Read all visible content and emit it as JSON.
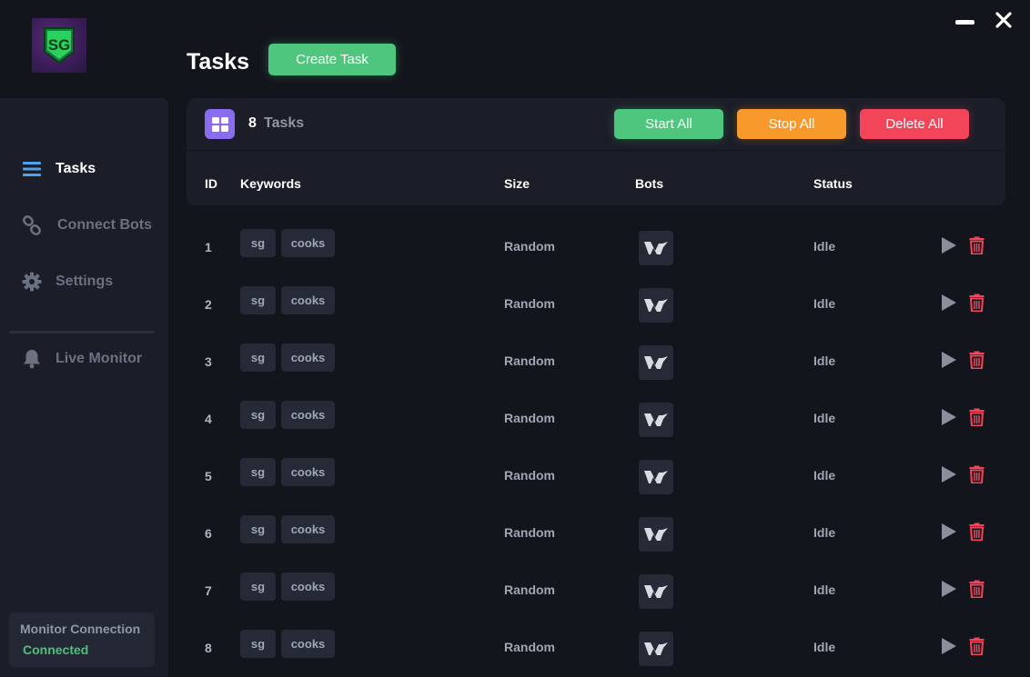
{
  "app": {
    "logo_text": "SG",
    "window": {
      "minimize_icon": "minimize-icon",
      "close_icon": "close-icon"
    }
  },
  "sidebar": {
    "items": [
      {
        "label": "Tasks",
        "icon": "list-icon",
        "active": true
      },
      {
        "label": "Connect Bots",
        "icon": "link-icon",
        "active": false
      },
      {
        "label": "Settings",
        "icon": "gear-icon",
        "active": false
      },
      {
        "label": "Live Monitor",
        "icon": "bell-icon",
        "active": false
      }
    ],
    "monitor": {
      "title": "Monitor Connection",
      "status": "Connected"
    }
  },
  "header": {
    "title": "Tasks",
    "create_label": "Create Task"
  },
  "panel": {
    "count": "8",
    "count_label": "Tasks",
    "start_all_label": "Start All",
    "stop_all_label": "Stop All",
    "delete_all_label": "Delete All",
    "columns": [
      "ID",
      "Keywords",
      "Size",
      "Bots",
      "Status"
    ]
  },
  "tasks": [
    {
      "id": "1",
      "keywords": [
        "sg",
        "cooks"
      ],
      "size": "Random",
      "bot_icon": "bot-logo-icon",
      "status": "Idle"
    },
    {
      "id": "2",
      "keywords": [
        "sg",
        "cooks"
      ],
      "size": "Random",
      "bot_icon": "bot-logo-icon",
      "status": "Idle"
    },
    {
      "id": "3",
      "keywords": [
        "sg",
        "cooks"
      ],
      "size": "Random",
      "bot_icon": "bot-logo-icon",
      "status": "Idle"
    },
    {
      "id": "4",
      "keywords": [
        "sg",
        "cooks"
      ],
      "size": "Random",
      "bot_icon": "bot-logo-icon",
      "status": "Idle"
    },
    {
      "id": "5",
      "keywords": [
        "sg",
        "cooks"
      ],
      "size": "Random",
      "bot_icon": "bot-logo-icon",
      "status": "Idle"
    },
    {
      "id": "6",
      "keywords": [
        "sg",
        "cooks"
      ],
      "size": "Random",
      "bot_icon": "bot-logo-icon",
      "status": "Idle"
    },
    {
      "id": "7",
      "keywords": [
        "sg",
        "cooks"
      ],
      "size": "Random",
      "bot_icon": "bot-logo-icon",
      "status": "Idle"
    },
    {
      "id": "8",
      "keywords": [
        "sg",
        "cooks"
      ],
      "size": "Random",
      "bot_icon": "bot-logo-icon",
      "status": "Idle"
    }
  ],
  "colors": {
    "background": "#13151d",
    "panel": "#1b1e28",
    "green": "#4fc67d",
    "orange": "#f79a2b",
    "red": "#f2455a",
    "purple": "#8a6cf0",
    "accent_blue": "#4ea3ea"
  }
}
